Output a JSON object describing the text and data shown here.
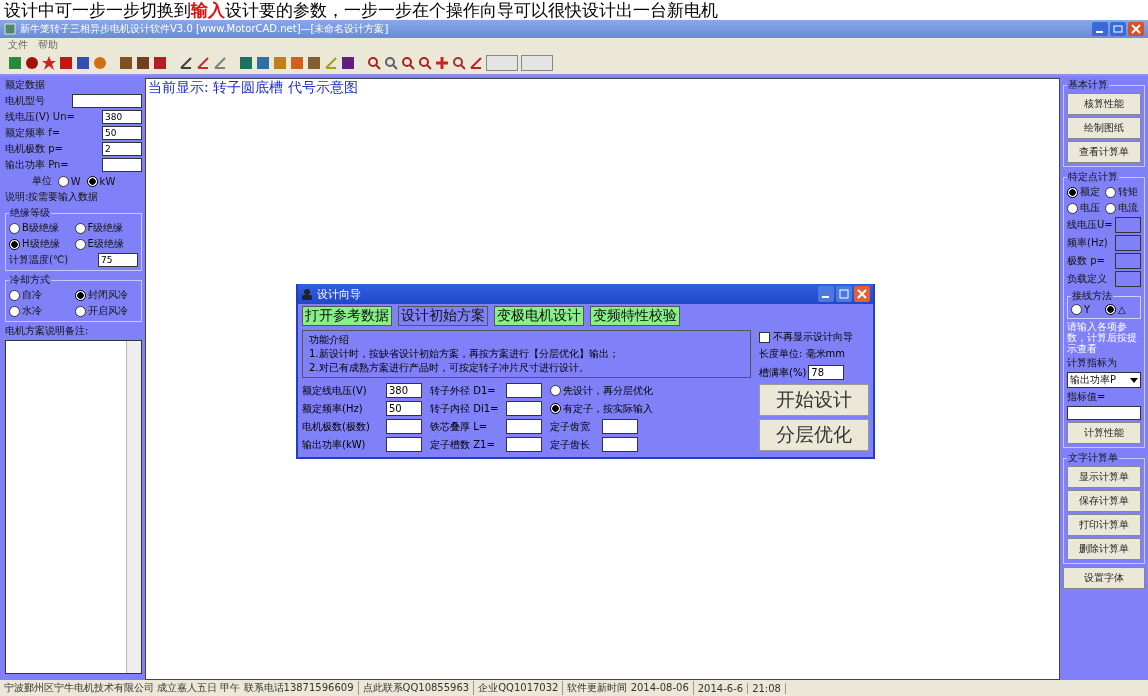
{
  "doc_line": "设计中可一步一步切换到**输入**设计要的参数，一步一步在个操作向导可以很快设计出一台新电机",
  "window": {
    "title": "新牛笼转子三相异步电机设计软件V3.0  [www.MotorCAD.net]—[未命名设计方案]"
  },
  "menu": [
    "文件",
    "帮助"
  ],
  "left_panel": {
    "title": "额定数据",
    "fields": [
      {
        "label": "电机型号"
      },
      {
        "label": "线电压(V) Un=",
        "value": "380"
      },
      {
        "label": "额定频率 f=",
        "value": "50"
      },
      {
        "label": "电机极数   p=",
        "value": "2"
      },
      {
        "label": "输出功率  Pn="
      }
    ],
    "unit": {
      "label": "单位",
      "options": [
        {
          "label": "W",
          "selected": false
        },
        {
          "label": "kW",
          "selected": true
        }
      ]
    },
    "note": "说明:按需要输入数据",
    "insulation": {
      "title": "绝缘等级",
      "options": [
        {
          "label": "B级绝缘",
          "selected": false
        },
        {
          "label": "F级绝缘",
          "selected": false
        },
        {
          "label": "H级绝缘",
          "selected": true
        },
        {
          "label": "E级绝缘",
          "selected": false
        }
      ],
      "temp_label": "计算温度(℃)",
      "temp_value": "75"
    },
    "cooling": {
      "title": "冷却方式",
      "options": [
        {
          "label": "自冷",
          "selected": false
        },
        {
          "label": "封闭风冷",
          "selected": true
        },
        {
          "label": "水冷",
          "selected": false
        },
        {
          "label": "开启风冷",
          "selected": false
        }
      ]
    },
    "remarks_label": "电机方案说明备注:"
  },
  "canvas": {
    "caption": "当前显示:   转子圆底槽  代号示意图"
  },
  "dialog": {
    "title": "设计向导",
    "tabs": [
      {
        "label": "打开参考数据",
        "highlighted": true
      },
      {
        "label": "设计初始方案",
        "highlighted": false
      },
      {
        "label": "变极电机设计",
        "highlighted": true
      },
      {
        "label": "变频特性校验",
        "highlighted": true
      }
    ],
    "info_title": "功能介绍",
    "info_lines": [
      "1.新设计时，按缺省设计初始方案，再按方案进行【分层优化】输出；",
      "2.对已有成熟方案进行产品时，可按定转子冲片尺寸进行设计。"
    ],
    "dont_show": {
      "label": "不再显示设计向导",
      "checked": false
    },
    "length_unit": "长度单位: 毫米mm",
    "slot_fill": {
      "label": "槽满率(%)",
      "value": "78"
    },
    "col1": [
      {
        "label": "额定线电压(V)",
        "value": "380"
      },
      {
        "label": "额定频率(Hz)",
        "value": "50"
      },
      {
        "label": "电机极数(极数)"
      },
      {
        "label": "输出功率(kW)"
      }
    ],
    "col2": [
      {
        "label": "转子外径 D1="
      },
      {
        "label": "转子内径 Di1="
      },
      {
        "label": "铁芯叠厚  L="
      },
      {
        "label": "定子槽数  Z1="
      }
    ],
    "modes": [
      {
        "label": "先设计，再分层优化",
        "selected": false
      },
      {
        "label": "有定子，按实际输入",
        "selected": true
      }
    ],
    "col3": [
      {
        "label": "定子齿宽"
      },
      {
        "label": "定子齿长"
      }
    ],
    "actions": [
      "开始设计",
      "分层优化"
    ]
  },
  "right_panel": {
    "basic": {
      "title": "基本计算",
      "buttons": [
        "核算性能",
        "绘制图纸",
        "查看计算单"
      ]
    },
    "point": {
      "title": "特定点计算",
      "options": [
        {
          "label": "额定",
          "selected": true
        },
        {
          "label": "转矩",
          "selected": false
        },
        {
          "label": "电压",
          "selected": false
        },
        {
          "label": "电流",
          "selected": false
        }
      ],
      "fields": [
        {
          "label": "线电压U=",
          "disabled": true
        },
        {
          "label": "频率(Hz)",
          "disabled": true
        },
        {
          "label": "极数 p=",
          "disabled": true
        },
        {
          "label": "负载定义",
          "disabled": true
        }
      ],
      "wiring": {
        "title": "接线方法",
        "options": [
          {
            "label": "Y",
            "selected": false
          },
          {
            "label": "△",
            "selected": true
          }
        ]
      },
      "hint": "请输入各项参数，计算后按提示查看",
      "target_label": "计算指标为",
      "target_value": "输出功率P",
      "value_label": "指标值=",
      "button": "计算性能"
    },
    "sheet": {
      "title": "文字计算单",
      "buttons": [
        "显示计算单",
        "保存计算单",
        "打印计算单",
        "删除计算单"
      ]
    },
    "font_button": "设置字体"
  },
  "status_bar": [
    "宁波鄞州区宁牛电机技术有限公司 成立嘉人五日 甲午 联系电话13871596609",
    "点此联系QQ10855963",
    "企业QQ1017032",
    "软件更新时间 2014-08-06",
    "2014-6-6",
    "21:08"
  ]
}
